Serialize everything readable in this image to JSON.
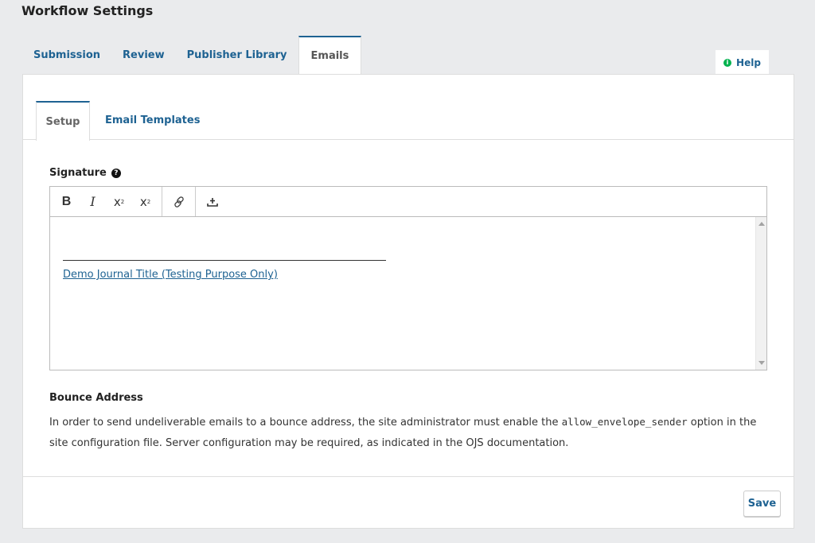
{
  "page": {
    "title": "Workflow Settings"
  },
  "top_tabs": [
    {
      "label": "Submission",
      "active": false
    },
    {
      "label": "Review",
      "active": false
    },
    {
      "label": "Publisher Library",
      "active": false
    },
    {
      "label": "Emails",
      "active": true
    }
  ],
  "help": {
    "label": "Help",
    "icon": "info-icon",
    "icon_glyph": "i"
  },
  "sub_tabs": [
    {
      "label": "Setup",
      "active": true
    },
    {
      "label": "Email Templates",
      "active": false
    }
  ],
  "signature": {
    "label": "Signature",
    "help_icon_glyph": "?",
    "toolbar": {
      "bold": "B",
      "italic": "I",
      "superscript": "x",
      "superscript_mark": "2",
      "subscript": "x",
      "subscript_mark": "2",
      "link_icon": "link-icon",
      "upload_icon": "upload-icon"
    },
    "content_link": "Demo Journal Title (Testing Purpose Only)"
  },
  "bounce": {
    "title": "Bounce Address",
    "desc_part1": "In order to send undeliverable emails to a bounce address, the site administrator must enable the ",
    "desc_code": "allow_envelope_sender",
    "desc_part2": " option in the site configuration file. Server configuration may be required, as indicated in the OJS documentation."
  },
  "footer": {
    "save_label": "Save"
  },
  "colors": {
    "accent": "#1e6292",
    "help_icon": "#00b24e",
    "background": "#eaebed"
  }
}
